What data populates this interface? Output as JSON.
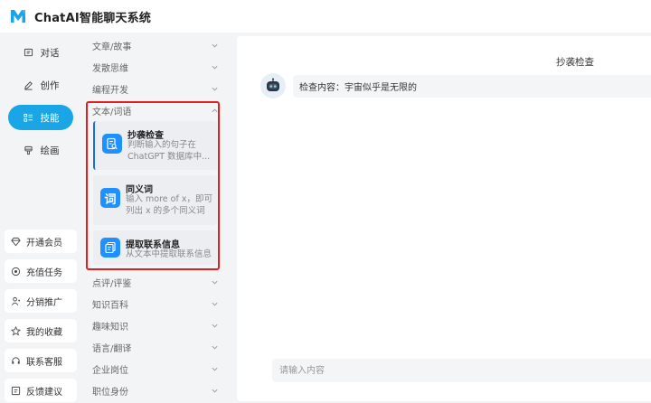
{
  "app": {
    "title": "ChatAI智能聊天系统"
  },
  "nav": {
    "items": [
      {
        "label": "对话",
        "icon": "chat-icon",
        "active": false
      },
      {
        "label": "创作",
        "icon": "edit-icon",
        "active": false
      },
      {
        "label": "技能",
        "icon": "skills-icon",
        "active": true
      },
      {
        "label": "绘画",
        "icon": "paint-icon",
        "active": false
      }
    ],
    "bottom": [
      {
        "label": "开通会员",
        "icon": "vip-diamond-icon"
      },
      {
        "label": "充值任务",
        "icon": "recharge-icon"
      },
      {
        "label": "分销推广",
        "icon": "user-share-icon"
      },
      {
        "label": "我的收藏",
        "icon": "star-icon"
      },
      {
        "label": "联系客服",
        "icon": "headset-icon"
      },
      {
        "label": "反馈建议",
        "icon": "feedback-icon"
      }
    ]
  },
  "categories": {
    "top": [
      "文章/故事",
      "发散思维",
      "编程开发"
    ],
    "open": "文本/词语",
    "skills": [
      {
        "title": "抄袭检查",
        "desc": "判断输入的句子在 ChatGPT 数据库中...",
        "icon_char": "",
        "selected": true
      },
      {
        "title": "同义词",
        "desc": "输入 more of x，即可列出 x 的多个同义词",
        "icon_char": "词",
        "selected": false
      },
      {
        "title": "提取联系信息",
        "desc": "从文本中提取联系信息",
        "icon_char": "",
        "selected": false
      }
    ],
    "bottom": [
      "点评/评鉴",
      "知识百科",
      "趣味知识",
      "语言/翻译",
      "企业岗位",
      "职位身份"
    ]
  },
  "chat": {
    "title": "抄袭检查",
    "message": "检查内容：宇宙似乎是无限的",
    "input_placeholder": "请输入内容"
  },
  "colors": {
    "accent": "#1aa5e6",
    "skill_icon": "#1e90ff",
    "highlight": "#e02020"
  }
}
